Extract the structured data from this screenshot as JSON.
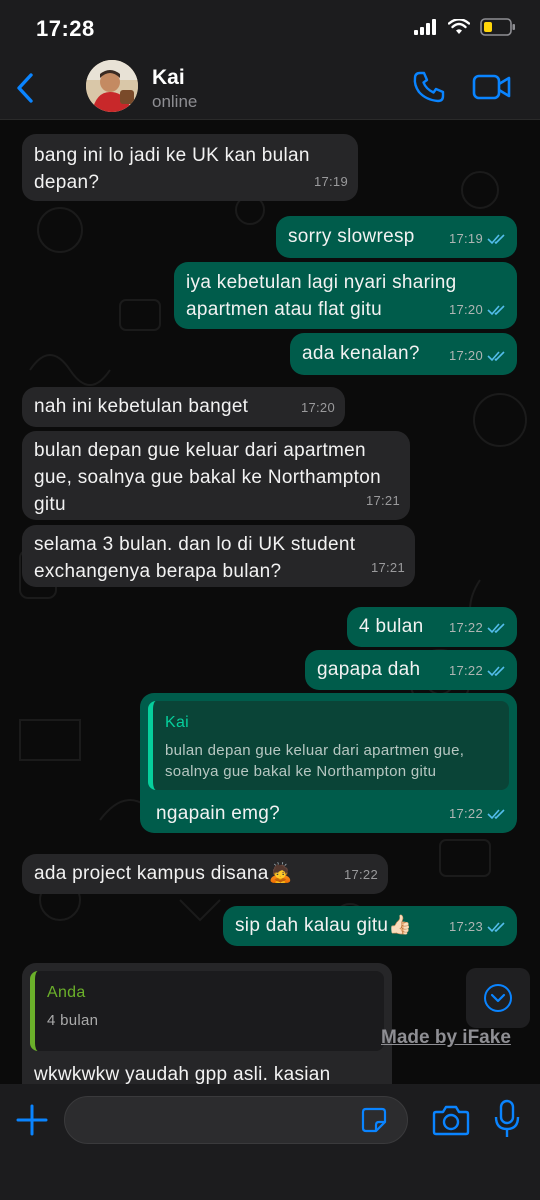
{
  "status_bar": {
    "time": "17:28"
  },
  "header": {
    "contact_name": "Kai",
    "contact_status": "online"
  },
  "messages": [
    {
      "text": "bang ini lo jadi ke UK kan bulan depan?",
      "time": "17:19"
    },
    {
      "text": "sorry slowresp",
      "time": "17:19"
    },
    {
      "text": "iya kebetulan lagi nyari sharing apartmen atau flat gitu",
      "time": "17:20"
    },
    {
      "text": "ada kenalan?",
      "time": "17:20"
    },
    {
      "text": "nah ini kebetulan banget",
      "time": "17:20"
    },
    {
      "text": "bulan depan gue keluar dari apartmen gue, soalnya gue bakal ke Northampton gitu",
      "time": "17:21"
    },
    {
      "text": "selama 3 bulan. dan lo di UK student exchangenya berapa bulan?",
      "time": "17:21"
    },
    {
      "text": "4 bulan",
      "time": "17:22"
    },
    {
      "text": "gapapa dah",
      "time": "17:22"
    },
    {
      "text": "ngapain emg?",
      "time": "17:22",
      "quote_name": "Kai",
      "quote_text": "bulan depan gue keluar dari apartmen gue, soalnya gue bakal ke Northampton gitu"
    },
    {
      "text": "ada project kampus disana",
      "emoji": "🙇",
      "time": "17:22"
    },
    {
      "text": "sip dah kalau gitu",
      "emoji": "👍🏻",
      "time": "17:23"
    },
    {
      "text": "wkwkwkw yaudah gpp asli. kasian",
      "quote_name": "Anda",
      "quote_text": "4 bulan"
    }
  ],
  "watermark": "Made by iFake",
  "input": {
    "placeholder": ""
  },
  "colors": {
    "accent": "#0a84ff",
    "outgoing_bubble": "#005c4b",
    "incoming_bubble": "#262628",
    "read_ticks": "#53bdeb"
  }
}
